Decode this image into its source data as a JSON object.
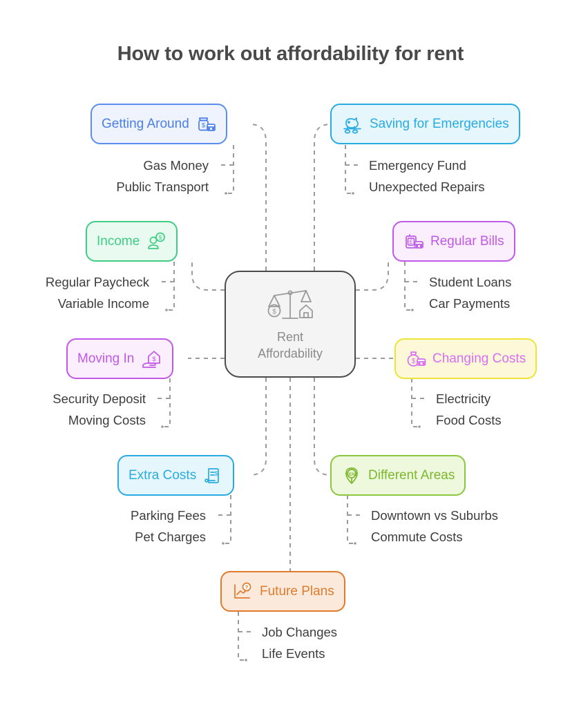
{
  "title": "How to work out affordability for rent",
  "center": {
    "label": "Rent\nAffordability",
    "icon": "scales-balance-money-house-icon",
    "border_color": "#4a4a4a",
    "fill_color": "#f4f4f4",
    "text_color": "#8a8a8a"
  },
  "branches": [
    {
      "id": "getting-around",
      "label": "Getting Around",
      "icon": "money-bag-bus-icon",
      "icon_side": "right",
      "border_color": "#5b8def",
      "fill_color": "#eef3fe",
      "text_color": "#4a7fe8",
      "side": "left",
      "children": [
        "Gas Money",
        "Public Transport"
      ]
    },
    {
      "id": "saving-for-emergencies",
      "label": "Saving for Emergencies",
      "icon": "piggy-bank-coins-icon",
      "icon_side": "left",
      "border_color": "#29abe2",
      "fill_color": "#e6f6fd",
      "text_color": "#29abe2",
      "side": "right",
      "children": [
        "Emergency Fund",
        "Unexpected Repairs"
      ]
    },
    {
      "id": "income",
      "label": "Income",
      "icon": "person-dollar-coin-icon",
      "icon_side": "right",
      "border_color": "#3fcc83",
      "fill_color": "#e9fbf1",
      "text_color": "#3fcc83",
      "side": "left",
      "children": [
        "Regular Paycheck",
        "Variable Income"
      ]
    },
    {
      "id": "regular-bills",
      "label": "Regular Bills",
      "icon": "pound-bill-bus-icon",
      "icon_side": "left",
      "border_color": "#c159e8",
      "fill_color": "#fbeefd",
      "text_color": "#c159e8",
      "side": "right",
      "children": [
        "Student Loans",
        "Car Payments"
      ]
    },
    {
      "id": "moving-in",
      "label": "Moving In",
      "icon": "house-dollar-hand-icon",
      "icon_side": "right",
      "border_color": "#c159e8",
      "fill_color": "#fbeefd",
      "text_color": "#c159e8",
      "side": "left",
      "children": [
        "Security Deposit",
        "Moving Costs"
      ]
    },
    {
      "id": "changing-costs",
      "label": "Changing Costs",
      "icon": "money-pouch-bus-icon",
      "icon_side": "left",
      "border_color": "#ede436",
      "fill_color": "#fdf8d8",
      "text_color": "#d96ef0",
      "side": "right",
      "children": [
        "Electricity",
        "Food Costs"
      ]
    },
    {
      "id": "extra-costs",
      "label": "Extra Costs",
      "icon": "invoice-dollar-icon",
      "icon_side": "right",
      "border_color": "#29abe2",
      "fill_color": "#e6f6fd",
      "text_color": "#29abe2",
      "side": "left",
      "children": [
        "Parking Fees",
        "Pet Charges"
      ]
    },
    {
      "id": "different-areas",
      "label": "Different Areas",
      "icon": "rent-map-pin-icon",
      "icon_side": "left",
      "border_color": "#8cc63e",
      "fill_color": "#eef8dc",
      "text_color": "#7cb82f",
      "side": "right",
      "children": [
        "Downtown vs Suburbs",
        "Commute Costs"
      ]
    },
    {
      "id": "future-plans",
      "label": "Future Plans",
      "icon": "growth-chart-question-icon",
      "icon_side": "left",
      "border_color": "#e07b2c",
      "fill_color": "#fbeadb",
      "text_color": "#e07b2c",
      "side": "bottom",
      "children": [
        "Job Changes",
        "Life Events"
      ]
    }
  ],
  "style": {
    "edge_color": "#9a9a9a",
    "background": "#ffffff",
    "title_color": "#4a4a4a",
    "sub_text_color": "#3d3d3d"
  }
}
